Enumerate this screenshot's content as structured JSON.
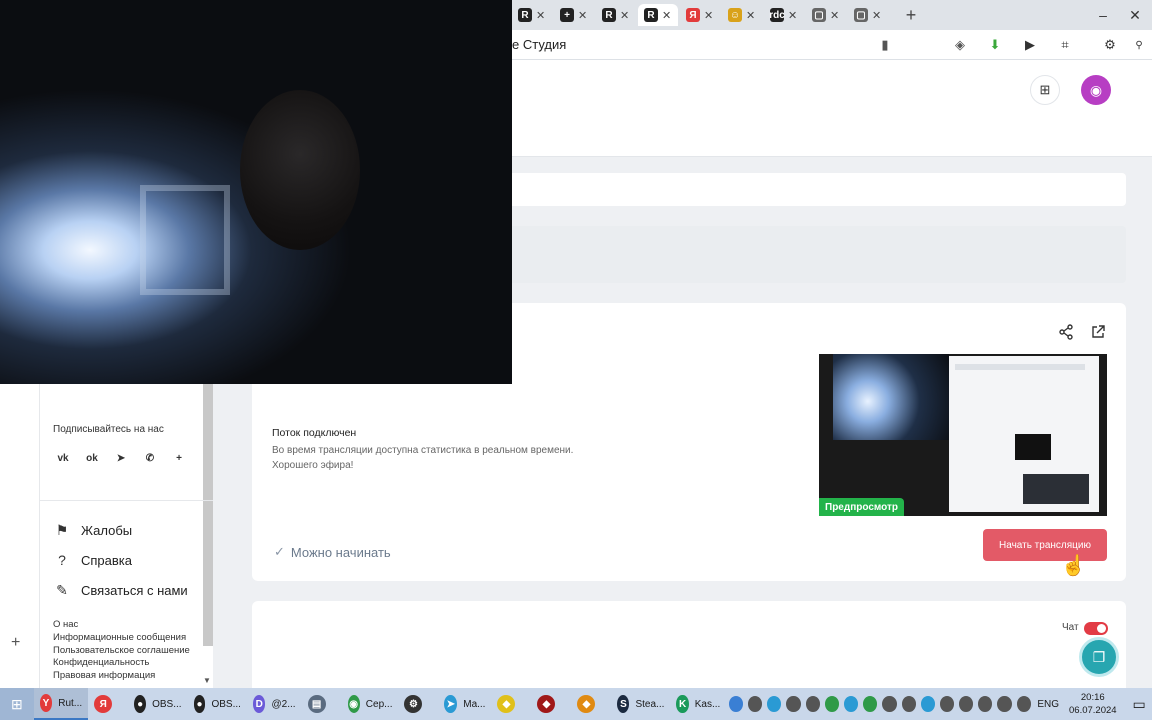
{
  "browser": {
    "page_title": "е Студия",
    "tabs": [
      {
        "icon": "R",
        "color": "#222222",
        "label": ""
      },
      {
        "icon": "+",
        "color": "#222222",
        "label": ""
      },
      {
        "icon": "R",
        "color": "#222222",
        "label": ""
      },
      {
        "icon": "R",
        "color": "#222222",
        "label": "",
        "active": true
      },
      {
        "icon": "Я",
        "color": "#e23b3b",
        "label": ""
      },
      {
        "icon": "☺",
        "color": "#d9a21a",
        "label": ""
      },
      {
        "icon": "rdc",
        "color": "#222222",
        "label": ""
      },
      {
        "icon": "▢",
        "color": "#666666",
        "label": ""
      },
      {
        "icon": "▢",
        "color": "#666666",
        "label": ""
      }
    ]
  },
  "sidebar": {
    "subscribe_label": "Подписывайтесь на нас",
    "social": [
      "vk-icon",
      "ok-icon",
      "telegram-icon",
      "whatsapp-icon",
      "plus-icon"
    ],
    "items": [
      {
        "name": "sidebar-item-complaints",
        "icon": "flag-icon",
        "glyph": "⚑",
        "label": "Жалобы"
      },
      {
        "name": "sidebar-item-help",
        "icon": "question-icon",
        "glyph": "?",
        "label": "Справка"
      },
      {
        "name": "sidebar-item-contact",
        "icon": "pencil-icon",
        "glyph": "✎",
        "label": "Связаться с нами"
      }
    ],
    "links": [
      "О нас",
      "Информационные сообщения",
      "Пользовательское соглашение",
      "Конфиденциальность",
      "Правовая информация"
    ]
  },
  "stream": {
    "status_title": "Поток подключен",
    "status_line1": "Во время трансляции доступна статистика в реальном времени.",
    "status_line2": "Хорошего эфира!",
    "ready_label": "Можно начинать",
    "preview_label": "Предпросмотр",
    "start_button": "Начать трансляцию",
    "chat_label": "Чат",
    "chat_enabled": true
  },
  "taskbar": {
    "apps": [
      {
        "name": "yandex-browser-app",
        "label": "Rut...",
        "color": "#e23b3b",
        "glyph": "Y",
        "active": true
      },
      {
        "name": "yandex-app",
        "label": "",
        "color": "#e23b3b",
        "glyph": "Я"
      },
      {
        "name": "obs-app-1",
        "label": "OBS...",
        "color": "#222222",
        "glyph": "●"
      },
      {
        "name": "obs-app-2",
        "label": "OBS...",
        "color": "#222222",
        "glyph": "●"
      },
      {
        "name": "discord-app",
        "label": "@2...",
        "color": "#6b5ad8",
        "glyph": "D"
      },
      {
        "name": "explorer-app",
        "label": "",
        "color": "#5a6b80",
        "glyph": "▤"
      },
      {
        "name": "chrome-app",
        "label": "Сер...",
        "color": "#2f9a48",
        "glyph": "◉"
      },
      {
        "name": "settings-app",
        "label": "",
        "color": "#333333",
        "glyph": "⚙"
      },
      {
        "name": "telegram-app",
        "label": "Ma...",
        "color": "#2a9ad4",
        "glyph": "➤"
      },
      {
        "name": "app-yellow",
        "label": "",
        "color": "#e0c01a",
        "glyph": "◆"
      },
      {
        "name": "app-red",
        "label": "",
        "color": "#a01818",
        "glyph": "◆"
      },
      {
        "name": "app-orange",
        "label": "",
        "color": "#e08a12",
        "glyph": "◆"
      },
      {
        "name": "steam-app",
        "label": "Stea...",
        "color": "#1b2a40",
        "glyph": "S"
      },
      {
        "name": "kaspersky-app",
        "label": "Kas...",
        "color": "#1a9a5a",
        "glyph": "K"
      }
    ],
    "tray_colors": [
      "#3a7fd4",
      "#555555",
      "#2a9ad4",
      "#555555",
      "#555555",
      "#2f9a48",
      "#2a9ad4",
      "#2f9a48",
      "#555555",
      "#555555",
      "#2a9ad4",
      "#555555",
      "#555555",
      "#555555",
      "#555555",
      "#555555"
    ],
    "language": "ENG",
    "time": "20:16",
    "date": "06.07.2024"
  }
}
